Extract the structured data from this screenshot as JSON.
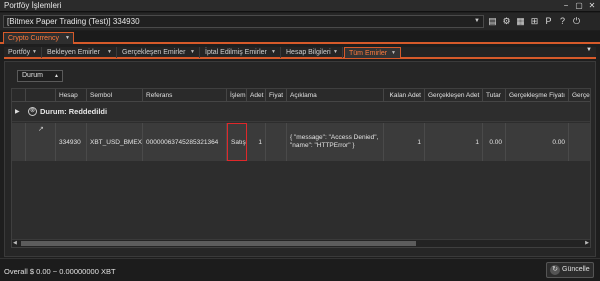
{
  "window": {
    "title": "Portföy İşlemleri",
    "min_icon": "minimize-icon",
    "max_icon": "maximize-icon",
    "close_icon": "close-icon",
    "min_glyph": "−",
    "max_glyph": "▢",
    "close_glyph": "✕"
  },
  "toolbar": {
    "account_value": "[Bitmex Paper Trading (Test)] 334930",
    "dropdown_glyph": "▼",
    "icons": [
      {
        "name": "layout-icon",
        "glyph": "▤"
      },
      {
        "name": "settings-icon",
        "glyph": "⚙"
      },
      {
        "name": "grid-icon",
        "glyph": "▦"
      },
      {
        "name": "network-icon",
        "glyph": "⊞"
      },
      {
        "name": "portfolio-icon",
        "glyph": "P"
      },
      {
        "name": "help-icon",
        "glyph": "?"
      },
      {
        "name": "power-icon",
        "glyph": "⏻"
      }
    ]
  },
  "category_tab": {
    "label": "Crypto Currency",
    "dropdown_glyph": "▼"
  },
  "subtabs": [
    {
      "label": "Portföy",
      "active": false
    },
    {
      "label": "Bekleyen Emirler",
      "active": false
    },
    {
      "label": "Gerçekleşen Emirler",
      "active": false
    },
    {
      "label": "İptal Edilmiş Emirler",
      "active": false
    },
    {
      "label": "Hesap Bilgileri",
      "active": false
    },
    {
      "label": "Tüm Emirler",
      "active": true
    }
  ],
  "subtab_dropdown_glyph": "▼",
  "group_by": {
    "label": "Durum",
    "glyph": "▲"
  },
  "grid": {
    "columns": [
      "",
      "",
      "Hesap",
      "Sembol",
      "Referans",
      "İşlem",
      "Adet",
      "Fiyat",
      "Açıklama",
      "Kalan Adet",
      "Gerçekleşen Adet",
      "Tutar",
      "Gerçekleşme Fiyatı",
      "Gerçe"
    ],
    "group": {
      "arrow": "▶",
      "icon_glyph": "⊗",
      "label": "Durum: Reddedildi"
    },
    "row": {
      "edit_glyph": "↗",
      "hesap": "334930",
      "sembol": "XBT_USD_BMEX",
      "referans": "00000063745285321364",
      "islem": "Satış",
      "adet": "1",
      "fiyat": "",
      "aciklama": "{ \"message\": \"Access Denied\", \"name\": \"HTTPError\" }",
      "kalan_adet": "1",
      "gerceklesen_adet": "1",
      "tutar": "0.00",
      "gerceklesme_fiyati": "0.00",
      "gerce": ""
    },
    "scroll_left": "◀",
    "scroll_right": "▶"
  },
  "status": {
    "summary": "Overall $ 0.00 ~ 0.00000000 XBT",
    "refresh_label": "Güncelle",
    "refresh_glyph": "↻"
  }
}
